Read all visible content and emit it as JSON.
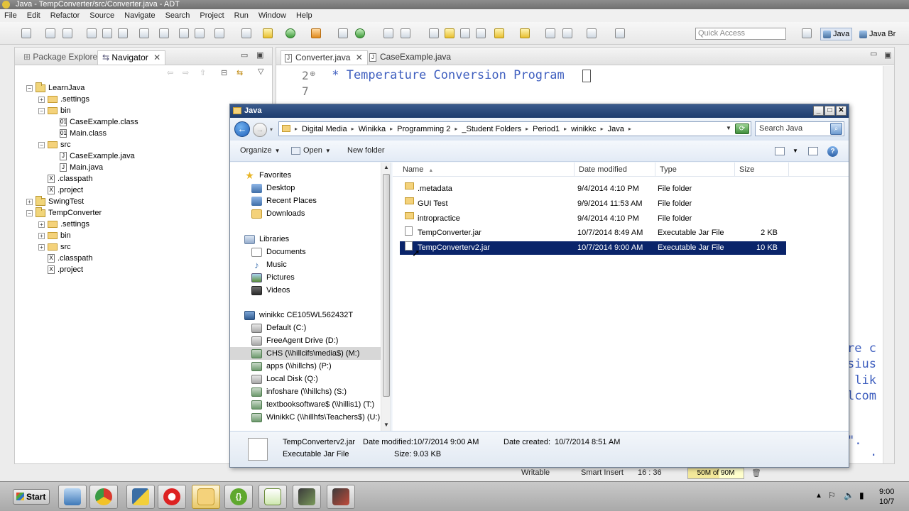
{
  "eclipse": {
    "title": "Java - TempConverter/src/Converter.java - ADT",
    "menu": [
      "File",
      "Edit",
      "Refactor",
      "Source",
      "Navigate",
      "Search",
      "Project",
      "Run",
      "Window",
      "Help"
    ],
    "quick_access_placeholder": "Quick Access",
    "perspectives": [
      "Java",
      "Java Br"
    ],
    "left_tabs": [
      "Package Explorer",
      "Navigator"
    ],
    "tree": [
      {
        "label": "LearnJava",
        "kind": "project",
        "level": 0,
        "expanded": true
      },
      {
        "label": ".settings",
        "kind": "folder",
        "level": 1,
        "expanded": false
      },
      {
        "label": "bin",
        "kind": "folder",
        "level": 1,
        "expanded": true
      },
      {
        "label": "CaseExample.class",
        "kind": "file",
        "level": 2
      },
      {
        "label": "Main.class",
        "kind": "file",
        "level": 2
      },
      {
        "label": "src",
        "kind": "folder",
        "level": 1,
        "expanded": true
      },
      {
        "label": "CaseExample.java",
        "kind": "file",
        "level": 2
      },
      {
        "label": "Main.java",
        "kind": "file",
        "level": 2
      },
      {
        "label": ".classpath",
        "kind": "file",
        "level": 1
      },
      {
        "label": ".project",
        "kind": "file",
        "level": 1
      },
      {
        "label": "SwingTest",
        "kind": "project",
        "level": 0,
        "expanded": false
      },
      {
        "label": "TempConverter",
        "kind": "project",
        "level": 0,
        "expanded": true
      },
      {
        "label": ".settings",
        "kind": "folder",
        "level": 1,
        "expanded": false
      },
      {
        "label": "bin",
        "kind": "folder",
        "level": 1,
        "expanded": false
      },
      {
        "label": "src",
        "kind": "folder",
        "level": 1,
        "expanded": false
      },
      {
        "label": ".classpath",
        "kind": "file",
        "level": 1
      },
      {
        "label": ".project",
        "kind": "file",
        "level": 1
      }
    ],
    "editor_tabs": [
      "Converter.java",
      "CaseExample.java"
    ],
    "code_line_numbers": [
      "2",
      "7"
    ],
    "code_comment": " * Temperature Conversion Program",
    "code_right_fragments": [
      "re c",
      "sius",
      " lik",
      "lcom",
      "\".",
      "."
    ],
    "status": {
      "writable": "Writable",
      "insert_mode": "Smart Insert",
      "cursor": "16 : 36",
      "heap": "50M of 90M",
      "heap_fraction": 0.56
    }
  },
  "explorer": {
    "title": "Java",
    "breadcrumbs": [
      "Digital Media",
      "Winikka",
      "Programming 2",
      "_Student Folders",
      "Period1",
      "winikkc",
      "Java"
    ],
    "search_placeholder": "Search Java",
    "commands": {
      "organize": "Organize",
      "open": "Open",
      "new_folder": "New folder"
    },
    "nav": {
      "favorites": "Favorites",
      "favorites_items": [
        "Desktop",
        "Recent Places",
        "Downloads"
      ],
      "libraries": "Libraries",
      "libraries_items": [
        "Documents",
        "Music",
        "Pictures",
        "Videos"
      ],
      "computer": "winikkc CE105WL562432T",
      "drives": [
        "Default (C:)",
        "FreeAgent Drive (D:)",
        "CHS (\\\\hillcifs\\media$) (M:)",
        "apps (\\\\hillchs) (P:)",
        "Local Disk (Q:)",
        "infoshare (\\\\hillchs) (S:)",
        "textbooksoftware$ (\\\\hillis1) (T:)",
        "WinikkC (\\\\hillhfs\\Teachers$) (U:)"
      ],
      "selected_drive_index": 2
    },
    "columns": [
      "Name",
      "Date modified",
      "Type",
      "Size"
    ],
    "files": [
      {
        "name": ".metadata",
        "modified": "9/4/2014 4:10 PM",
        "type": "File folder",
        "size": "",
        "kind": "folder"
      },
      {
        "name": "GUI Test",
        "modified": "9/9/2014 11:53 AM",
        "type": "File folder",
        "size": "",
        "kind": "folder"
      },
      {
        "name": "intropractice",
        "modified": "9/4/2014 4:10 PM",
        "type": "File folder",
        "size": "",
        "kind": "folder"
      },
      {
        "name": "TempConverter.jar",
        "modified": "10/7/2014 8:49 AM",
        "type": "Executable Jar File",
        "size": "2 KB",
        "kind": "jar"
      },
      {
        "name": "TempConverterv2.jar",
        "modified": "10/7/2014 9:00 AM",
        "type": "Executable Jar File",
        "size": "10 KB",
        "kind": "jar",
        "selected": true
      }
    ],
    "details": {
      "name": "TempConverterv2.jar",
      "modified_label": "Date modified:",
      "modified": "10/7/2014 9:00 AM",
      "created_label": "Date created:",
      "created": "10/7/2014 8:51 AM",
      "type": "Executable Jar File",
      "size_label": "Size:",
      "size": "9.03 KB"
    }
  },
  "taskbar": {
    "start": "Start",
    "clock_time": "9:00",
    "clock_date": "10/7"
  }
}
